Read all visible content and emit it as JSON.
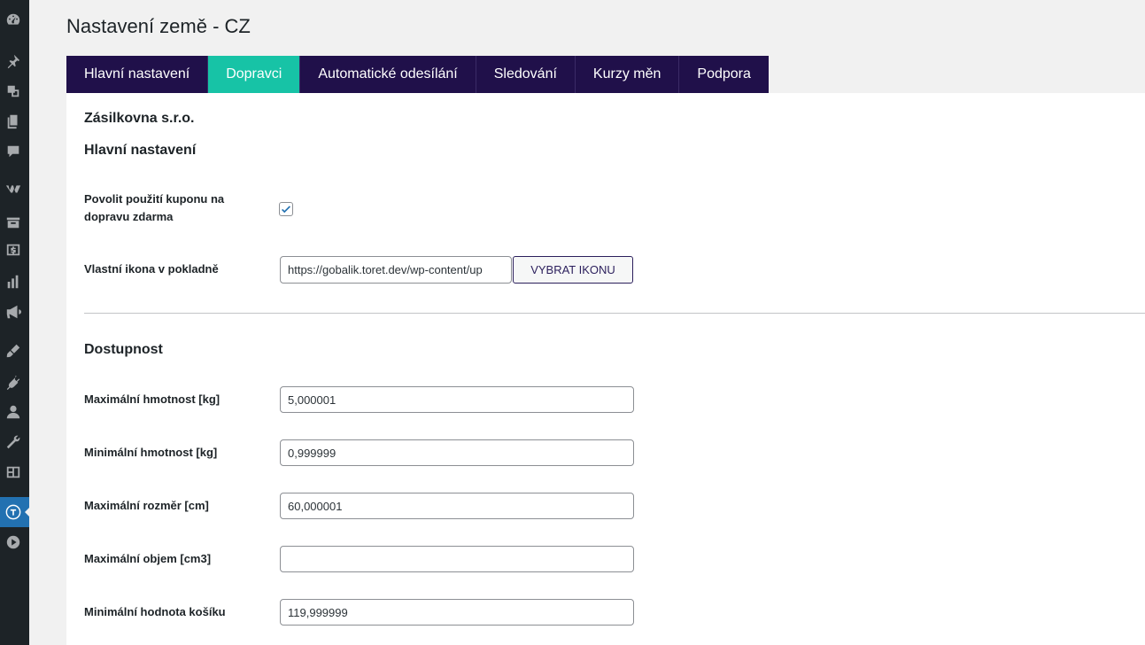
{
  "page": {
    "title": "Nastavení země - CZ"
  },
  "tabs": [
    {
      "label": "Hlavní nastavení",
      "active": false
    },
    {
      "label": "Dopravci",
      "active": true
    },
    {
      "label": "Automatické odesílání",
      "active": false
    },
    {
      "label": "Sledování",
      "active": false
    },
    {
      "label": "Kurzy měn",
      "active": false
    },
    {
      "label": "Podpora",
      "active": false
    }
  ],
  "carrier": {
    "name": "Zásilkovna s.r.o."
  },
  "main_settings": {
    "heading": "Hlavní nastavení",
    "coupon_label": "Povolit použití kuponu na dopravu zdarma",
    "coupon_checked": true,
    "icon_label": "Vlastní ikona v pokladně",
    "icon_url": "https://gobalik.toret.dev/wp-content/up",
    "icon_button": "VYBRAT IKONU"
  },
  "availability": {
    "heading": "Dostupnost",
    "fields": [
      {
        "label": "Maximální hmotnost [kg]",
        "value": "5,000001"
      },
      {
        "label": "Minimální hmotnost [kg]",
        "value": "0,999999"
      },
      {
        "label": "Maximální rozměr [cm]",
        "value": "60,000001"
      },
      {
        "label": "Maximální objem [cm3]",
        "value": ""
      },
      {
        "label": "Minimální hodnota košíku",
        "value": "119,999999"
      }
    ]
  },
  "sidebar_icons": [
    "dashboard-icon",
    "pin-icon",
    "media-icon",
    "pages-icon",
    "comments-icon",
    "woocommerce-icon",
    "products-icon",
    "payments-icon",
    "analytics-icon",
    "marketing-icon",
    "appearance-icon",
    "plugins-icon",
    "users-icon",
    "tools-icon",
    "settings-icon",
    "toret-icon",
    "play-icon"
  ],
  "colors": {
    "tab_bg": "#20104a",
    "tab_active": "#17c3a6",
    "sidebar_bg": "#1d2327",
    "sidebar_active": "#2271b1"
  }
}
